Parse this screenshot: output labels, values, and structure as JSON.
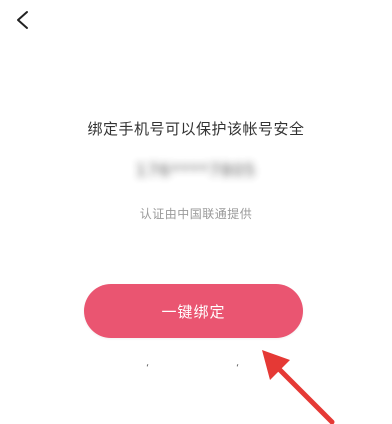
{
  "header": {
    "back_icon": "chevron-left-icon"
  },
  "main": {
    "title": "绑定手机号可以保护该帐号安全",
    "phone_masked": "176****7805",
    "subtitle": "认证由中国联通提供",
    "bind_button_label": "一键绑定"
  },
  "footer": {
    "mark_left": "‘",
    "mark_right": "‘"
  },
  "annotation": {
    "arrow_color": "#e53935"
  },
  "colors": {
    "accent": "#ea5571",
    "background": "#ffffff",
    "text": "#333333",
    "subtext": "#9a9a9a"
  }
}
